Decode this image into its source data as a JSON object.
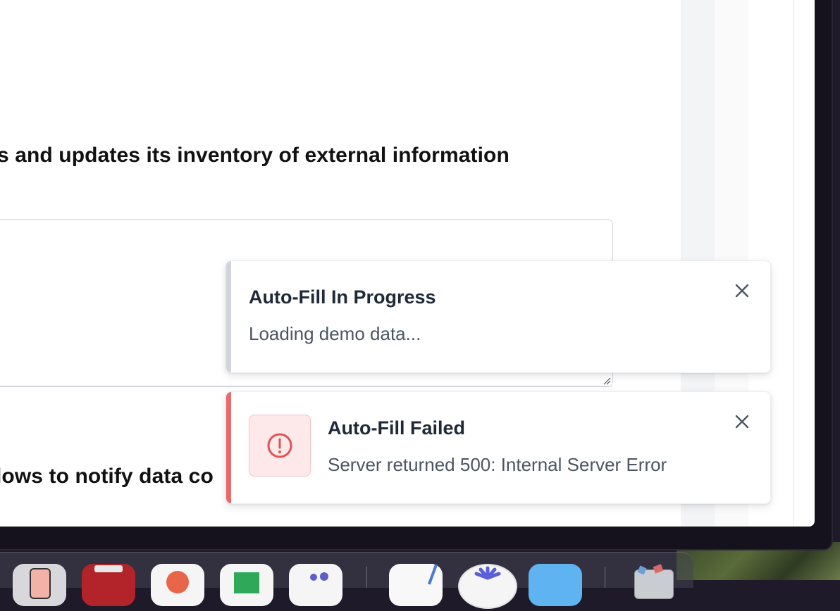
{
  "main": {
    "heading_top": "s and updates its inventory of external information",
    "heading_bottom": "lows to notify data co"
  },
  "toasts": [
    {
      "title": "Auto-Fill In Progress",
      "message": "Loading demo data...",
      "accent_color": "#d1d5db"
    },
    {
      "title": "Auto-Fill Failed",
      "message": "Server returned 500: Internal Server Error",
      "accent_color": "#e86a6a",
      "icon": "alert-circle-icon"
    }
  ],
  "dock": {
    "icons": [
      "iphone-mirroring-icon",
      "toolbox-icon",
      "presentation-icon",
      "numbers-icon",
      "teams-icon",
      "textedit-icon",
      "perplexity-icon",
      "folder-icon",
      "trash-icon"
    ]
  }
}
